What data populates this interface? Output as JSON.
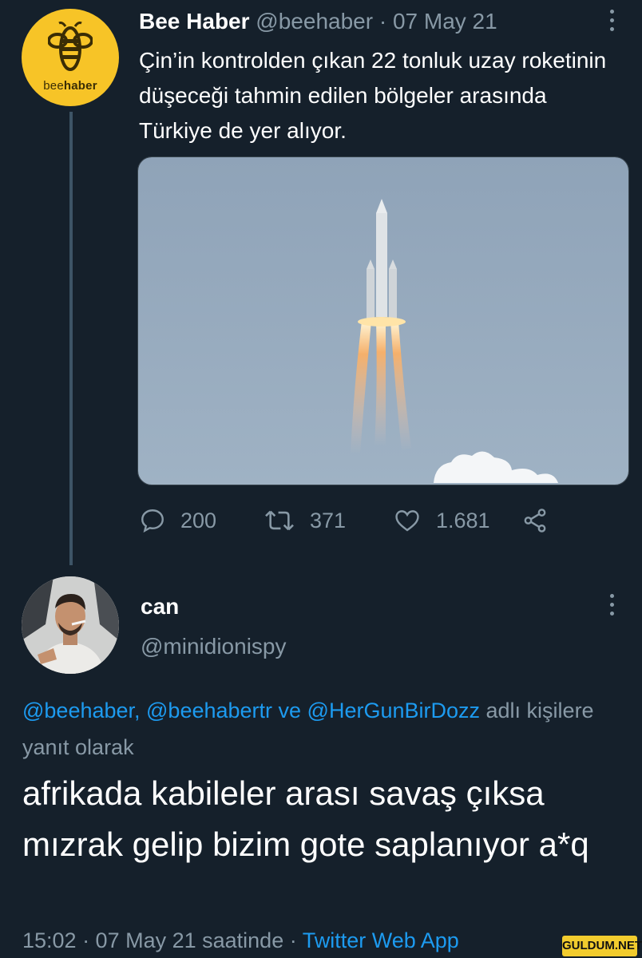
{
  "tweet1": {
    "name": "Bee Haber",
    "handle": "@beehaber",
    "separator": "·",
    "date": "07 May 21",
    "avatar_brand": {
      "prefix": "bee",
      "suffix": "haber"
    },
    "text": "Çin’in kontrolden çıkan 22 tonluk uzay roketinin düşeceği tahmin edilen bölgeler arasında Türkiye de yer alıyor.",
    "media_icon": "rocket-launch-image",
    "stats": {
      "replies": "200",
      "retweets": "371",
      "likes": "1.681"
    }
  },
  "tweet2": {
    "name": "can",
    "handle": "@minidionispy",
    "reply_mentions": "@beehaber, @beehabertr ve @HerGunBirDozz",
    "reply_suffix": " adlı kişilere yanıt olarak",
    "text": "afrikada kabileler arası savaş çıksa mızrak gelip bizim gote saplanıyor a*q",
    "timestamp": "15:02 · 07 May 21 saatinde · ",
    "source": "Twitter Web App"
  },
  "watermark": "GULDUM.NET",
  "colors": {
    "background": "#15202b",
    "link": "#1d9bf0",
    "muted": "#8899a6",
    "brand": "#f7c427"
  }
}
